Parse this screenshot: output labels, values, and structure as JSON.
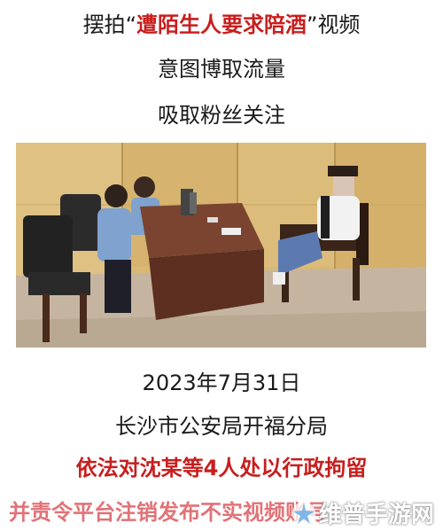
{
  "headline": {
    "prefix": "摆拍",
    "open_quote": "“",
    "highlight": "遭陌生人要求陪酒",
    "close_quote": "”",
    "suffix": "视频",
    "line2": "意图博取流量",
    "line3": "吸取粉丝关注"
  },
  "photo": {
    "scene": "interrogation-room",
    "colors": {
      "wall": "#d9b873",
      "floor": "#c7b7a3",
      "table": "#6e3a26",
      "uniform": "#7fa2cf"
    }
  },
  "info": {
    "date": "2023年7月31日",
    "agency": "长沙市公安局开福分局",
    "penalty": "依法对沈某等4人处以行政拘留",
    "order": "并责令平台注销发布不实视频账号"
  },
  "watermark": {
    "text": "维普手游网",
    "logo_icon": "starburst-logo-icon"
  },
  "colors": {
    "highlight_red": "#c81e1e",
    "faded_red": "#e06b70"
  }
}
